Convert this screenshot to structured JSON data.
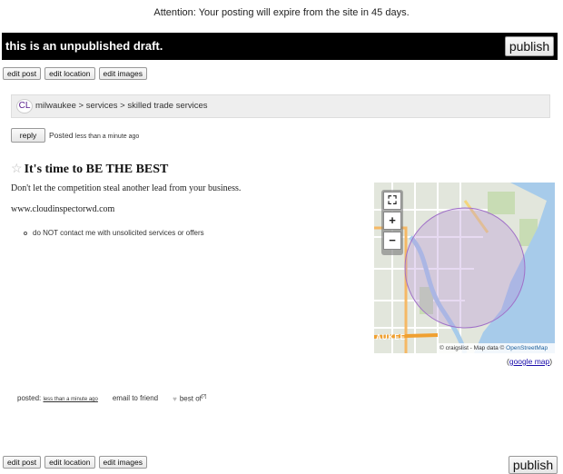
{
  "attention": "Attention: Your posting will expire from the site in 45 days.",
  "draft": {
    "text": "this is an unpublished draft.",
    "publish_label": "publish"
  },
  "edit_buttons": {
    "edit_post": "edit post",
    "edit_location": "edit location",
    "edit_images": "edit images"
  },
  "breadcrumb": {
    "badge": "CL",
    "path": "milwaukee > services > skilled trade services"
  },
  "reply": {
    "label": "reply",
    "posted_prefix": "Posted",
    "posted_time": "less than a minute ago"
  },
  "posting": {
    "title": "It's time to BE THE BEST",
    "line1": "Don't let the competition steal another lead from your business.",
    "line2": "www.cloudinspectorwd.com",
    "notice": "do NOT contact me with unsolicited services or offers"
  },
  "map": {
    "fullscreen_icon": "fullscreen-icon",
    "zoom_in": "+",
    "zoom_out": "−",
    "place_label": "AUKEE",
    "attribution_prefix": "© craigslist - Map data ©",
    "attribution_link": "OpenStreetMap",
    "google_map": "google map"
  },
  "footer": {
    "posted_label": "posted:",
    "posted_time": "less than a minute ago",
    "email": "email to friend",
    "best_of": "best of",
    "best_of_sup": "[?]"
  },
  "colors": {
    "draft_bar": "#000000",
    "breadcrumb_bg": "#eeeeee",
    "water": "#a7cbea",
    "radius": "#b58bd8"
  }
}
